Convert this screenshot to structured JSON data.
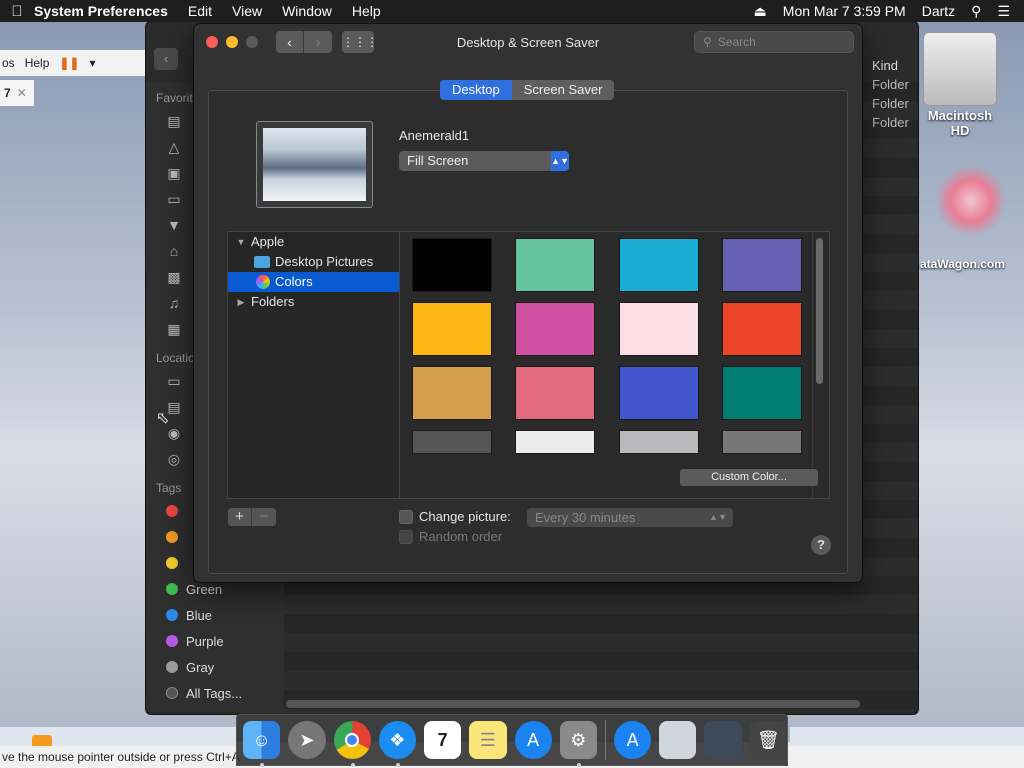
{
  "menubar": {
    "app_name": "System Preferences",
    "menus": [
      "Edit",
      "View",
      "Window",
      "Help"
    ],
    "clock": "Mon Mar 7  3:59 PM",
    "user": "Dartz"
  },
  "host": {
    "toolbar_help": "Help",
    "tab_label": "7",
    "status_text": "ve the mouse pointer outside or press Ctrl+A"
  },
  "finder": {
    "favorites_header": "Favorit",
    "locations_header": "Locatio",
    "tags_header": "Tags",
    "tags": [
      {
        "name": "Green",
        "color": "#3fbf4f"
      },
      {
        "name": "Blue",
        "color": "#2f87e8"
      },
      {
        "name": "Purple",
        "color": "#b35ae0"
      },
      {
        "name": "Gray",
        "color": "#9a9a9a"
      }
    ],
    "all_tags": "All Tags...",
    "kind_header": "Kind",
    "kind_values": [
      "Folder",
      "Folder",
      "Folder"
    ]
  },
  "desktop": {
    "hd_label": "Macintosh HD",
    "flower_label": "ataWagon.com"
  },
  "prefs": {
    "title": "Desktop & Screen Saver",
    "search_placeholder": "Search",
    "tab_desktop": "Desktop",
    "tab_screensaver": "Screen Saver",
    "wallpaper_name": "Anemerald1",
    "fit_option": "Fill Screen",
    "source_list": {
      "apple": "Apple",
      "desktop_pictures": "Desktop Pictures",
      "colors": "Colors",
      "folders": "Folders"
    },
    "swatches": [
      "#000000",
      "#66c3a0",
      "#19acd2",
      "#6660b2",
      "#fcb715",
      "#cf4fa0",
      "#fbdde6",
      "#ec4426",
      "#d5a04d",
      "#e16b7c",
      "#4256cd",
      "#007e74",
      "#565656",
      "#ececec",
      "#b9b9bb",
      "#777777"
    ],
    "custom_color_button": "Custom Color...",
    "change_picture_label": "Change picture:",
    "interval_value": "Every 30 minutes",
    "random_order_label": "Random order",
    "help_label": "?"
  }
}
